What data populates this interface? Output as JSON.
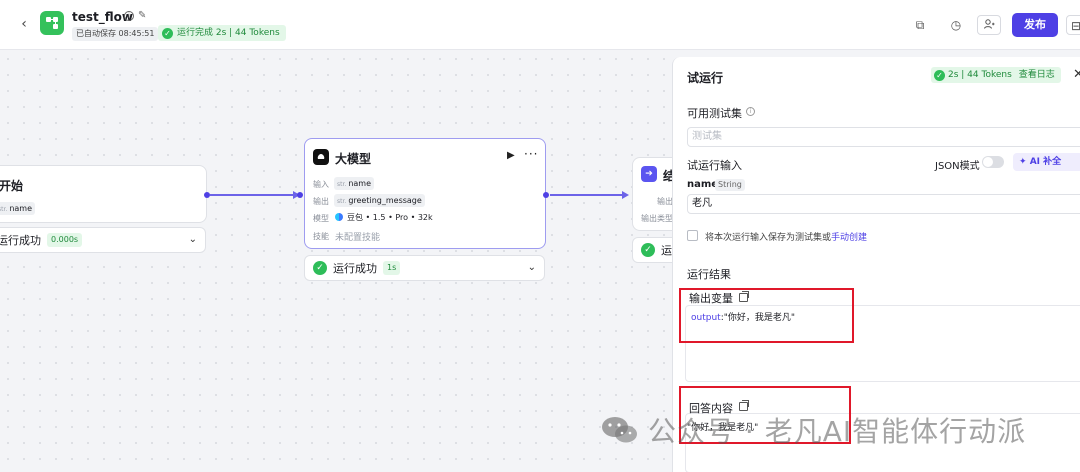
{
  "header": {
    "flow_name": "test_flow",
    "autosave": "已自动保存 08:45:51",
    "run_status": "运行完成 2s | 44 Tokens",
    "publish_label": "发布"
  },
  "canvas": {
    "start_node": {
      "title": "开始",
      "output_type": "str.",
      "output_name": "name",
      "status": "运行成功",
      "duration": "0.000s"
    },
    "llm_node": {
      "title": "大模型",
      "input_label": "输入",
      "input_type": "str.",
      "input_name": "name",
      "output_label": "输出",
      "output_type": "str.",
      "output_name": "greeting_message",
      "model_label": "模型",
      "model_value": "豆包 • 1.5 • Pro • 32k",
      "skills_label": "技能",
      "skills_value": "未配置技能",
      "status": "运行成功",
      "duration": "1s"
    },
    "end_node": {
      "title": "结",
      "output_label": "输出",
      "output_type_label": "输出类型",
      "status": "运行"
    }
  },
  "panel": {
    "title": "试运行",
    "badge": "2s | 44 Tokens",
    "view_log": "查看日志",
    "testsets_label": "可用测试集",
    "testsets_placeholder": "测试集",
    "input_section": "试运行输入",
    "json_mode": "JSON模式",
    "ai_fill": "AI 补全",
    "var_name": "name",
    "var_type": "String",
    "var_value": "老凡",
    "save_text": "将本次运行输入保存为测试集或",
    "save_link": "手动创建",
    "result_title": "运行结果",
    "output_vars_label": "输出变量",
    "output_key": "output",
    "output_value": ":\"你好，我是老凡\"",
    "answer_label": "回答内容",
    "answer_value": "\"你好，我是老凡\""
  },
  "watermark": {
    "text": "公众号 · 老凡AI智能体行动派"
  }
}
